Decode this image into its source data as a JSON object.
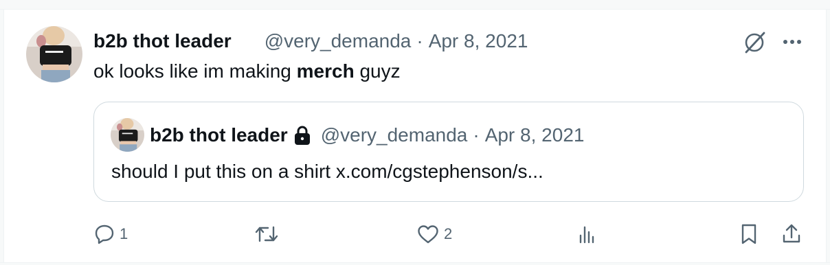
{
  "tweet": {
    "display_name": "b2b thot leader",
    "handle": "@very_demanda",
    "separator": "·",
    "date": "Apr 8, 2021",
    "text_before": "ok looks like im making ",
    "text_bold": "merch",
    "text_after": " guyz"
  },
  "quoted_tweet": {
    "display_name": "b2b thot leader",
    "handle": "@very_demanda",
    "separator": "·",
    "date": "Apr 8, 2021",
    "text": "should I put this on a shirt x.com/cgstephenson/s..."
  },
  "actions": {
    "reply_count": "1",
    "retweet_count": "",
    "like_count": "2",
    "views_count": ""
  },
  "icons": {
    "header": [
      "grok-icon",
      "more-icon"
    ],
    "actions": [
      "reply-icon",
      "retweet-icon",
      "like-icon",
      "views-icon",
      "bookmark-icon",
      "share-icon"
    ],
    "quoted_badge": "lock-icon"
  },
  "colors": {
    "text_primary": "#0f1419",
    "text_secondary": "#536471",
    "border": "#cfd9de"
  }
}
